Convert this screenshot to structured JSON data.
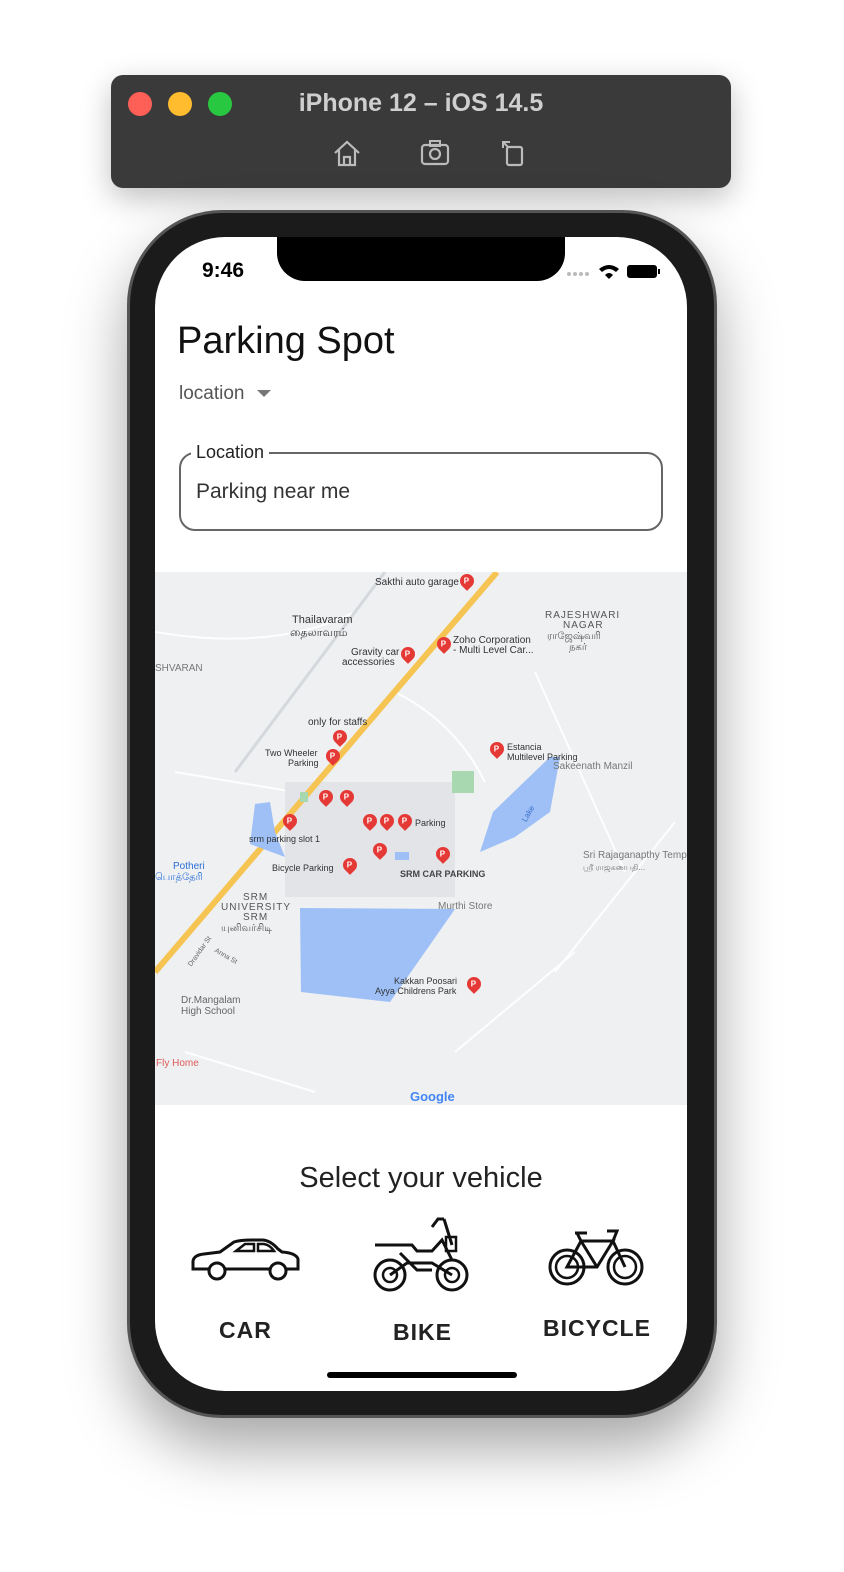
{
  "window": {
    "title": "iPhone 12 – iOS 14.5",
    "toolbar": [
      "home-icon",
      "screenshot-icon",
      "rotate-icon"
    ]
  },
  "status_bar": {
    "time": "9:46"
  },
  "app": {
    "title": "Parking Spot",
    "dropdown": {
      "value": "location"
    },
    "location_field": {
      "label": "Location",
      "value": "Parking near me"
    }
  },
  "map": {
    "labels": {
      "sakthi": "Sakthi auto garage",
      "thailavaram": "Thailavaram",
      "thailavaram_ta": "தைலாவரம்",
      "gravity1": "Gravity car",
      "gravity2": "accessories",
      "zoho1": "Zoho Corporation",
      "zoho2": "- Multi Level Car...",
      "rajeshwari1": "RAJESHWARI",
      "rajeshwari2": "NAGAR",
      "rajeshwari_ta1": "ராஜேஷ்வரி",
      "rajeshwari_ta2": "நகர்",
      "shvaran": "SHVARAN",
      "staffs": "only for staffs",
      "two1": "Two Wheeler",
      "two2": "Parking",
      "estancia1": "Estancia",
      "estancia2": "Multilevel Parking",
      "sakeenath": "Sakeenath Manzil",
      "lake": "Lake",
      "parking": "Parking",
      "slot": "srm parking slot 1",
      "bicycle": "Bicycle Parking",
      "srmcar": "SRM CAR PARKING",
      "potheri": "Potheri",
      "potheri_ta": "பொத்தேரி",
      "srm1": "SRM",
      "srm2": "UNIVERSITY",
      "srm3": "SRM",
      "srm_ta": "யுனிவர்சிடி",
      "murthi": "Murthi Store",
      "sri1": "Sri Rajaganapthy Temp",
      "sri_ta": "ஸ்ரீ ராஜகணபதி...",
      "kakkan1": "Kakkan Poosari",
      "kakkan2": "Ayya Childrens Park",
      "mangalam1": "Dr.Mangalam",
      "mangalam2": "High School",
      "flyhome": "Fly Home",
      "dravidar": "Dravidar St",
      "anna": "Anna St",
      "google": "Google"
    }
  },
  "vehicles": {
    "heading": "Select your vehicle",
    "items": [
      {
        "label": "CAR",
        "icon": "car-icon"
      },
      {
        "label": "BIKE",
        "icon": "motorbike-icon"
      },
      {
        "label": "BICYCLE",
        "icon": "bicycle-icon"
      }
    ]
  }
}
